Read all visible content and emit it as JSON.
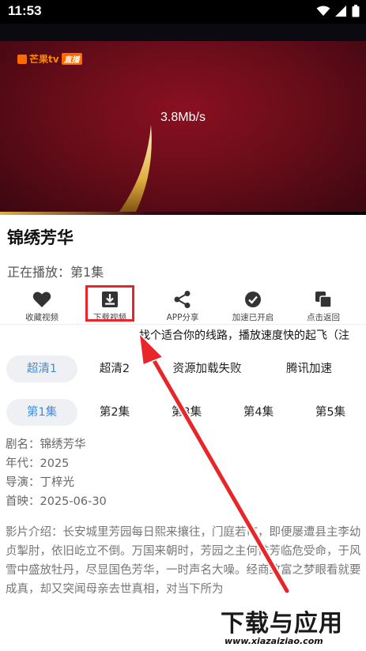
{
  "status_bar": {
    "time": "11:53"
  },
  "player": {
    "logo_text": "芒果tv",
    "logo_badge": "直播",
    "speed": "3.8Mb/s"
  },
  "video": {
    "title": "锦绣芳华",
    "now_playing_label": "正在播放：",
    "now_playing_episode": "第1集"
  },
  "actions": [
    {
      "label": "收藏视频",
      "icon": "heart-icon"
    },
    {
      "label": "下载视频",
      "icon": "download-icon"
    },
    {
      "label": "APP分享",
      "icon": "share-icon"
    },
    {
      "label": "加速已开启",
      "icon": "check-circle-icon"
    },
    {
      "label": "点击返回",
      "icon": "copy-icon"
    }
  ],
  "hint": "找个适合你的线路，播放速度快的起飞（注",
  "sources": [
    {
      "label": "超清1",
      "active": true
    },
    {
      "label": "超清2",
      "active": false
    },
    {
      "label": "资源加载失败",
      "active": false
    },
    {
      "label": "腾讯加速",
      "active": false
    }
  ],
  "episodes": [
    {
      "label": "第1集",
      "active": true
    },
    {
      "label": "第2集",
      "active": false
    },
    {
      "label": "第3集",
      "active": false
    },
    {
      "label": "第4集",
      "active": false
    },
    {
      "label": "第5集",
      "active": false
    }
  ],
  "info": {
    "name": "剧名：锦绣芳华",
    "year": "年代：2025",
    "director": "导演：丁梓光",
    "premiere": "首映：2025-06-30"
  },
  "intro": "影片介绍：长安城里芳园每日熙来攘往，门庭若市，即便屡遭县主李幼贞掣肘，依旧屹立不倒。万国来朝时，芳园之主何惟芳临危受命，于风雪中盛放牡丹，尽显国色芳华，一时声名大噪。经商致富之梦眼看就要成真，却又突闻母亲去世真相，对当下所为",
  "watermark": {
    "text": "下载与应用",
    "url": "www.xiazaiziao.com"
  },
  "colors": {
    "accent": "#3a8ee6",
    "highlight": "#e8262a",
    "player_bg": "#6a0d1a"
  }
}
